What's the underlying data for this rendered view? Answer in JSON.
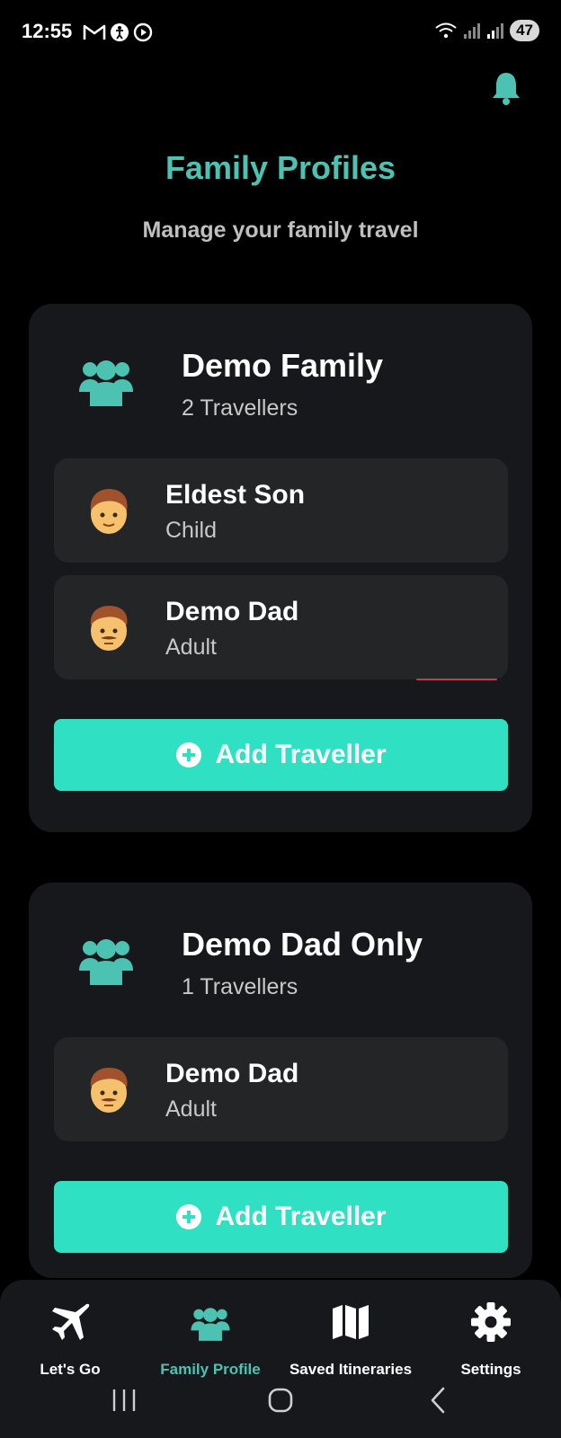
{
  "status_bar": {
    "time": "12:55",
    "battery": "47"
  },
  "header": {
    "title": "Family Profiles",
    "subtitle": "Manage your family travel"
  },
  "families": [
    {
      "name": "Demo Family",
      "count": "2 Travellers",
      "members": [
        {
          "name": "Eldest Son",
          "role": "Child",
          "avatar": "boy-emoji"
        },
        {
          "name": "Demo Dad",
          "role": "Adult",
          "avatar": "man-emoji"
        }
      ],
      "add_label": "Add Traveller"
    },
    {
      "name": "Demo Dad Only",
      "count": "1 Travellers",
      "members": [
        {
          "name": "Demo Dad",
          "role": "Adult",
          "avatar": "man-emoji"
        }
      ],
      "add_label": "Add Traveller"
    }
  ],
  "nav": {
    "items": [
      {
        "label": "Let's Go",
        "icon": "plane-icon",
        "active": false
      },
      {
        "label": "Family Profile",
        "icon": "users-icon",
        "active": true
      },
      {
        "label": "Saved Itineraries",
        "icon": "map-icon",
        "active": false
      },
      {
        "label": "Settings",
        "icon": "gear-icon",
        "active": false
      }
    ]
  },
  "colors": {
    "accent": "#4cc3b2",
    "button": "#2fe0c3",
    "card": "#16181b",
    "member_row": "#242526",
    "background": "#000000"
  }
}
